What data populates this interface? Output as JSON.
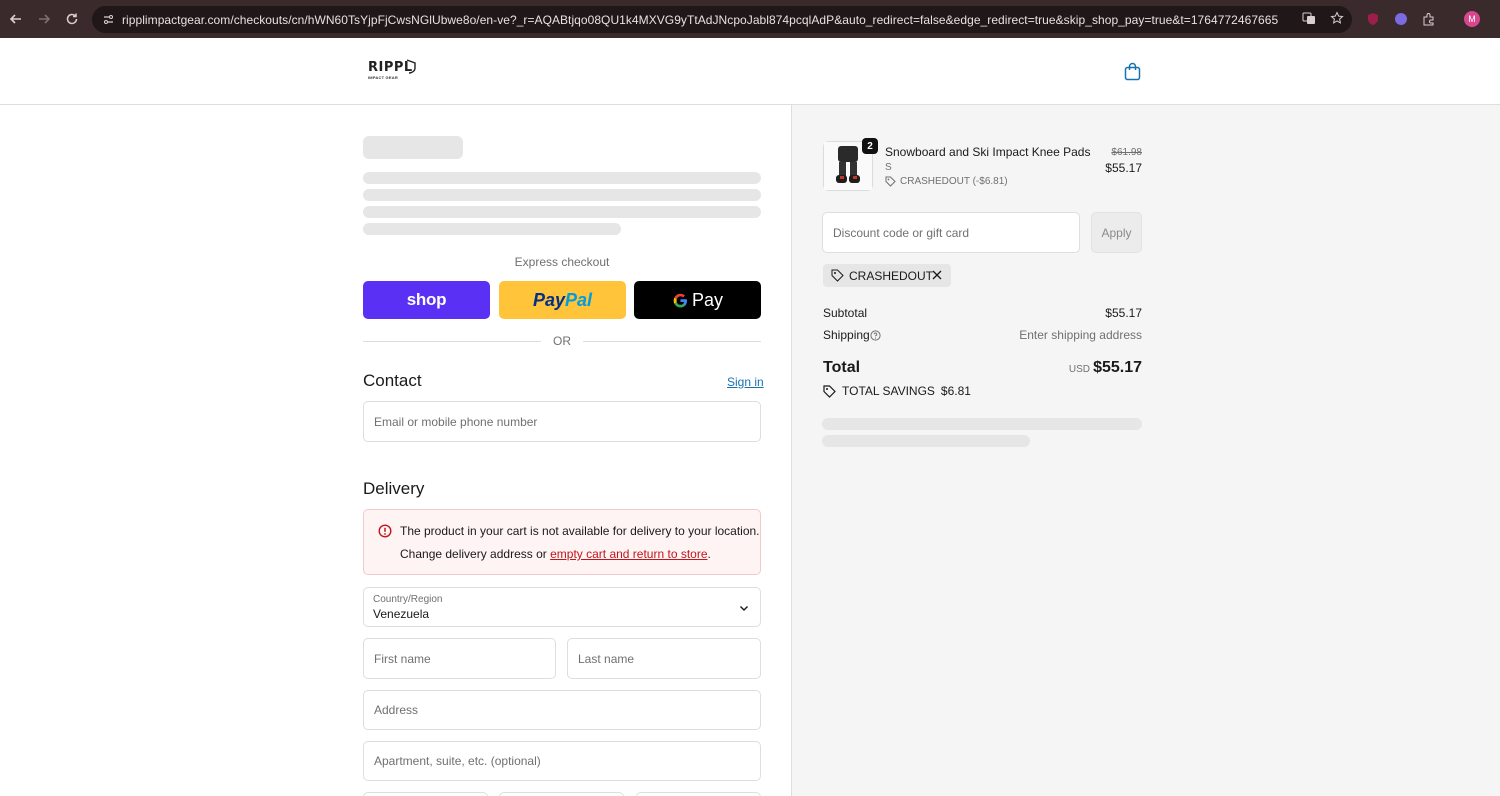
{
  "browser": {
    "url": "ripplimpactgear.com/checkouts/cn/hWN60TsYjpFjCwsNGlUbwe8o/en-ve?_r=AQABtjqo08QU1k4MXVG9yTtAdJNcpoJabl874pcqlAdP&auto_redirect=false&edge_redirect=true&skip_shop_pay=true&t=1764772467665",
    "avatar_letter": "M"
  },
  "header": {
    "logo_text": "RIPPL",
    "logo_subtext": "IMPACT GEAR"
  },
  "express": {
    "label": "Express checkout",
    "shop_label": "shop",
    "paypal_a": "Pay",
    "paypal_b": "Pal",
    "gpay_label": "Pay",
    "or_label": "OR"
  },
  "contact": {
    "heading": "Contact",
    "sign_in": "Sign in",
    "email_placeholder": "Email or mobile phone number"
  },
  "delivery": {
    "heading": "Delivery",
    "alert_line1": "The product in your cart is not available for delivery to your location.",
    "alert_line2_prefix": "Change delivery address or ",
    "alert_link": "empty cart and return to store",
    "alert_line2_suffix": ".",
    "country_label": "Country/Region",
    "country_value": "Venezuela",
    "first_name_placeholder": "First name",
    "last_name_placeholder": "Last name",
    "address_placeholder": "Address",
    "apartment_placeholder": "Apartment, suite, etc. (optional)"
  },
  "summary": {
    "item": {
      "quantity": "2",
      "title": "Snowboard and Ski Impact Knee Pads",
      "variant": "S",
      "discount": "CRASHEDOUT (-$6.81)",
      "original_price": "$61.98",
      "price": "$55.17"
    },
    "discount_placeholder": "Discount code or gift card",
    "apply_label": "Apply",
    "applied_code": "CRASHEDOUT",
    "subtotal_label": "Subtotal",
    "subtotal_value": "$55.17",
    "shipping_label": "Shipping",
    "shipping_value": "Enter shipping address",
    "total_label": "Total",
    "currency": "USD",
    "total_value": "$55.17",
    "savings_label": "TOTAL SAVINGS",
    "savings_value": "$6.81"
  },
  "colors": {
    "shop_pay": "#5a31f4",
    "paypal": "#ffc439",
    "link": "#1773b0",
    "error": "#c2151b"
  }
}
